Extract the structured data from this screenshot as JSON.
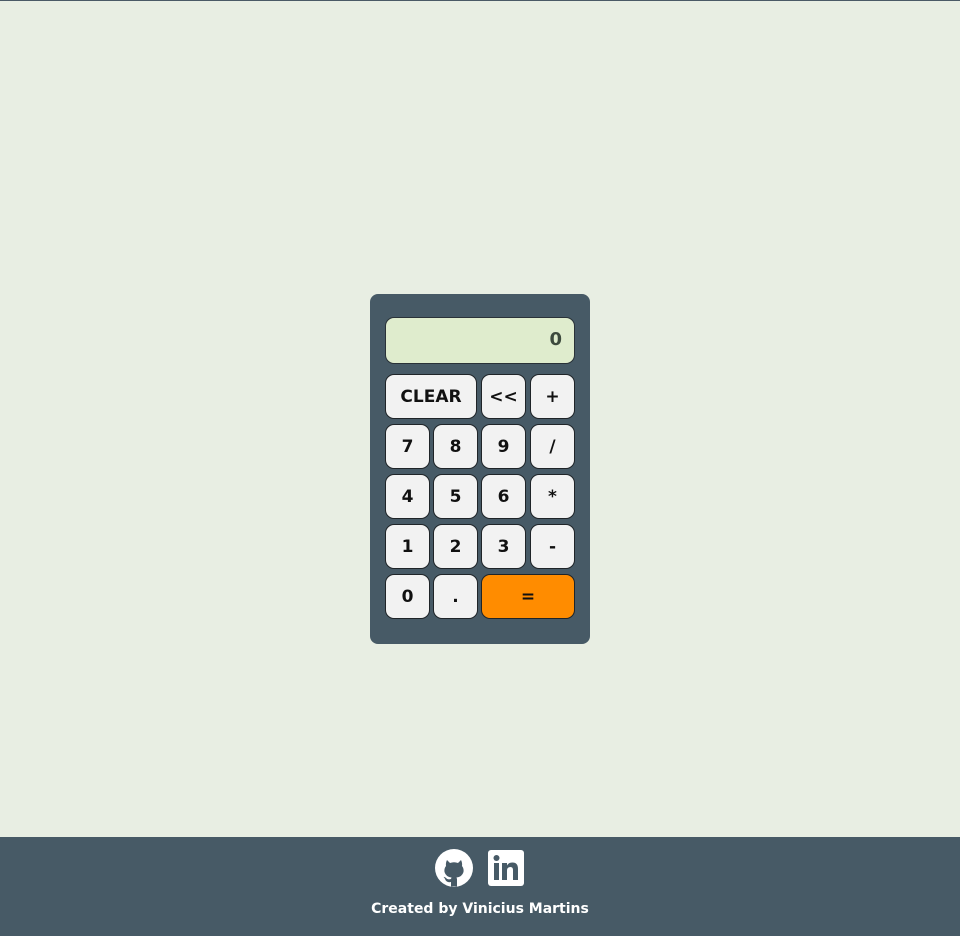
{
  "calculator": {
    "display": "0",
    "buttons": {
      "clear": "CLEAR",
      "backspace": "<<",
      "plus": "+",
      "seven": "7",
      "eight": "8",
      "nine": "9",
      "divide": "/",
      "four": "4",
      "five": "5",
      "six": "6",
      "multiply": "*",
      "one": "1",
      "two": "2",
      "three": "3",
      "minus": "-",
      "zero": "0",
      "dot": ".",
      "equals": "="
    },
    "colors": {
      "body": "#475a66",
      "display": "#dfeccd",
      "button": "#f2f2f2",
      "equals": "#ff8c00"
    }
  },
  "footer": {
    "links": [
      "github-icon",
      "linkedin-icon"
    ],
    "credit": "Created by Vinicius Martins"
  }
}
